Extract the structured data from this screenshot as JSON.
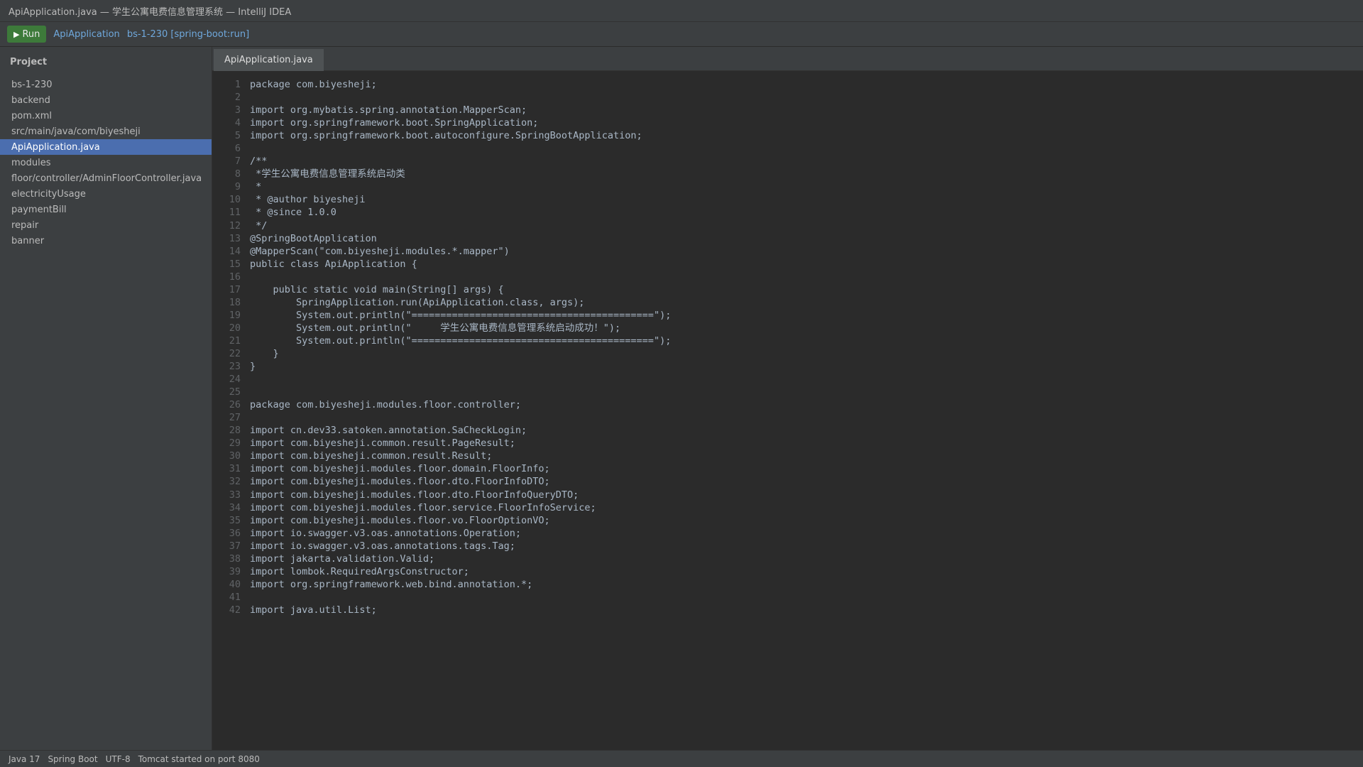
{
  "window": {
    "title": "ApiApplication.java — 学生公寓电费信息管理系统 — IntelliJ IDEA"
  },
  "toolbar": {
    "run_label": "Run",
    "run_icon": "play-icon",
    "config_name": "ApiApplication",
    "config_target": "bs-1-230 [spring-boot:run]"
  },
  "sidebar": {
    "header": "Project",
    "items": [
      {
        "label": "bs-1-230",
        "selected": false
      },
      {
        "label": "backend",
        "selected": false
      },
      {
        "label": "pom.xml",
        "selected": false
      },
      {
        "label": "src/main/java/com/biyesheji",
        "selected": false
      },
      {
        "label": "ApiApplication.java",
        "selected": true
      },
      {
        "label": "modules",
        "selected": false
      },
      {
        "label": "floor/controller/AdminFloorController.java",
        "selected": false
      },
      {
        "label": "electricityUsage",
        "selected": false
      },
      {
        "label": "paymentBill",
        "selected": false
      },
      {
        "label": "repair",
        "selected": false
      },
      {
        "label": "banner",
        "selected": false
      }
    ]
  },
  "editor": {
    "tab_label": "ApiApplication.java",
    "lines": [
      "package com.biyesheji;",
      "",
      "import org.mybatis.spring.annotation.MapperScan;",
      "import org.springframework.boot.SpringApplication;",
      "import org.springframework.boot.autoconfigure.SpringBootApplication;",
      "",
      "/**",
      " *学生公寓电费信息管理系统启动类",
      " *",
      " * @author biyesheji",
      " * @since 1.0.0",
      " */",
      "@SpringBootApplication",
      "@MapperScan(\"com.biyesheji.modules.*.mapper\")",
      "public class ApiApplication {",
      "",
      "    public static void main(String[] args) {",
      "        SpringApplication.run(ApiApplication.class, args);",
      "        System.out.println(\"==========================================\");",
      "        System.out.println(\"     学生公寓电费信息管理系统启动成功！\");",
      "        System.out.println(\"==========================================\");",
      "    }",
      "}",
      "",
      "",
      "package com.biyesheji.modules.floor.controller;",
      "",
      "import cn.dev33.satoken.annotation.SaCheckLogin;",
      "import com.biyesheji.common.result.PageResult;",
      "import com.biyesheji.common.result.Result;",
      "import com.biyesheji.modules.floor.domain.FloorInfo;",
      "import com.biyesheji.modules.floor.dto.FloorInfoDTO;",
      "import com.biyesheji.modules.floor.dto.FloorInfoQueryDTO;",
      "import com.biyesheji.modules.floor.service.FloorInfoService;",
      "import com.biyesheji.modules.floor.vo.FloorOptionVO;",
      "import io.swagger.v3.oas.annotations.Operation;",
      "import io.swagger.v3.oas.annotations.tags.Tag;",
      "import jakarta.validation.Valid;",
      "import lombok.RequiredArgsConstructor;",
      "import org.springframework.web.bind.annotation.*;",
      "",
      "import java.util.List;"
    ]
  },
  "statusbar": {
    "items": [
      "Java 17",
      "Spring Boot",
      "UTF-8",
      "Tomcat started on port 8080"
    ]
  },
  "colors": {
    "background": "#2b2b2b",
    "panel": "#3c3f41",
    "selection": "#4b6eaf",
    "run_button": "#3d7a3a",
    "config_link": "#6fa8dc",
    "code_text": "#a9b7c6",
    "line_number": "#606366"
  }
}
